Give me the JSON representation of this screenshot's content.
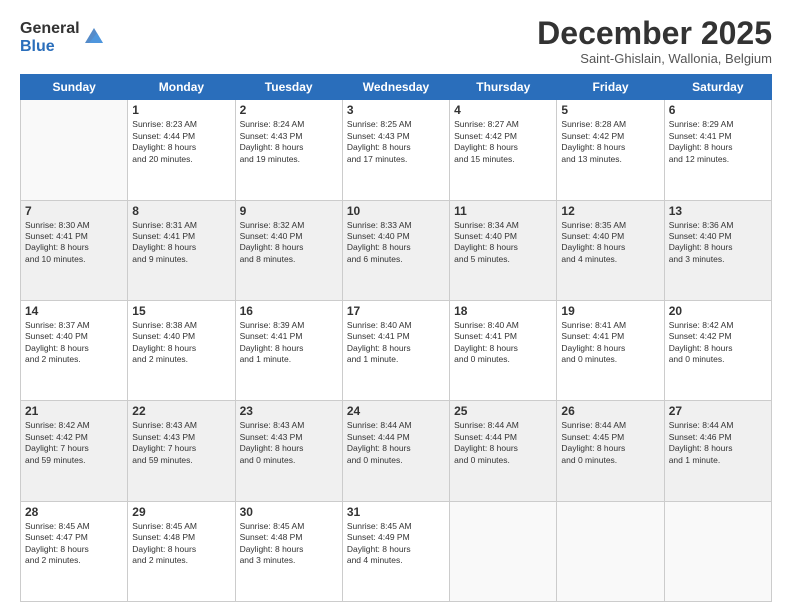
{
  "logo": {
    "general": "General",
    "blue": "Blue"
  },
  "header": {
    "month": "December 2025",
    "location": "Saint-Ghislain, Wallonia, Belgium"
  },
  "weekdays": [
    "Sunday",
    "Monday",
    "Tuesday",
    "Wednesday",
    "Thursday",
    "Friday",
    "Saturday"
  ],
  "weeks": [
    [
      {
        "day": "",
        "info": ""
      },
      {
        "day": "1",
        "info": "Sunrise: 8:23 AM\nSunset: 4:44 PM\nDaylight: 8 hours\nand 20 minutes."
      },
      {
        "day": "2",
        "info": "Sunrise: 8:24 AM\nSunset: 4:43 PM\nDaylight: 8 hours\nand 19 minutes."
      },
      {
        "day": "3",
        "info": "Sunrise: 8:25 AM\nSunset: 4:43 PM\nDaylight: 8 hours\nand 17 minutes."
      },
      {
        "day": "4",
        "info": "Sunrise: 8:27 AM\nSunset: 4:42 PM\nDaylight: 8 hours\nand 15 minutes."
      },
      {
        "day": "5",
        "info": "Sunrise: 8:28 AM\nSunset: 4:42 PM\nDaylight: 8 hours\nand 13 minutes."
      },
      {
        "day": "6",
        "info": "Sunrise: 8:29 AM\nSunset: 4:41 PM\nDaylight: 8 hours\nand 12 minutes."
      }
    ],
    [
      {
        "day": "7",
        "info": "Sunrise: 8:30 AM\nSunset: 4:41 PM\nDaylight: 8 hours\nand 10 minutes."
      },
      {
        "day": "8",
        "info": "Sunrise: 8:31 AM\nSunset: 4:41 PM\nDaylight: 8 hours\nand 9 minutes."
      },
      {
        "day": "9",
        "info": "Sunrise: 8:32 AM\nSunset: 4:40 PM\nDaylight: 8 hours\nand 8 minutes."
      },
      {
        "day": "10",
        "info": "Sunrise: 8:33 AM\nSunset: 4:40 PM\nDaylight: 8 hours\nand 6 minutes."
      },
      {
        "day": "11",
        "info": "Sunrise: 8:34 AM\nSunset: 4:40 PM\nDaylight: 8 hours\nand 5 minutes."
      },
      {
        "day": "12",
        "info": "Sunrise: 8:35 AM\nSunset: 4:40 PM\nDaylight: 8 hours\nand 4 minutes."
      },
      {
        "day": "13",
        "info": "Sunrise: 8:36 AM\nSunset: 4:40 PM\nDaylight: 8 hours\nand 3 minutes."
      }
    ],
    [
      {
        "day": "14",
        "info": "Sunrise: 8:37 AM\nSunset: 4:40 PM\nDaylight: 8 hours\nand 2 minutes."
      },
      {
        "day": "15",
        "info": "Sunrise: 8:38 AM\nSunset: 4:40 PM\nDaylight: 8 hours\nand 2 minutes."
      },
      {
        "day": "16",
        "info": "Sunrise: 8:39 AM\nSunset: 4:41 PM\nDaylight: 8 hours\nand 1 minute."
      },
      {
        "day": "17",
        "info": "Sunrise: 8:40 AM\nSunset: 4:41 PM\nDaylight: 8 hours\nand 1 minute."
      },
      {
        "day": "18",
        "info": "Sunrise: 8:40 AM\nSunset: 4:41 PM\nDaylight: 8 hours\nand 0 minutes."
      },
      {
        "day": "19",
        "info": "Sunrise: 8:41 AM\nSunset: 4:41 PM\nDaylight: 8 hours\nand 0 minutes."
      },
      {
        "day": "20",
        "info": "Sunrise: 8:42 AM\nSunset: 4:42 PM\nDaylight: 8 hours\nand 0 minutes."
      }
    ],
    [
      {
        "day": "21",
        "info": "Sunrise: 8:42 AM\nSunset: 4:42 PM\nDaylight: 7 hours\nand 59 minutes."
      },
      {
        "day": "22",
        "info": "Sunrise: 8:43 AM\nSunset: 4:43 PM\nDaylight: 7 hours\nand 59 minutes."
      },
      {
        "day": "23",
        "info": "Sunrise: 8:43 AM\nSunset: 4:43 PM\nDaylight: 8 hours\nand 0 minutes."
      },
      {
        "day": "24",
        "info": "Sunrise: 8:44 AM\nSunset: 4:44 PM\nDaylight: 8 hours\nand 0 minutes."
      },
      {
        "day": "25",
        "info": "Sunrise: 8:44 AM\nSunset: 4:44 PM\nDaylight: 8 hours\nand 0 minutes."
      },
      {
        "day": "26",
        "info": "Sunrise: 8:44 AM\nSunset: 4:45 PM\nDaylight: 8 hours\nand 0 minutes."
      },
      {
        "day": "27",
        "info": "Sunrise: 8:44 AM\nSunset: 4:46 PM\nDaylight: 8 hours\nand 1 minute."
      }
    ],
    [
      {
        "day": "28",
        "info": "Sunrise: 8:45 AM\nSunset: 4:47 PM\nDaylight: 8 hours\nand 2 minutes."
      },
      {
        "day": "29",
        "info": "Sunrise: 8:45 AM\nSunset: 4:48 PM\nDaylight: 8 hours\nand 2 minutes."
      },
      {
        "day": "30",
        "info": "Sunrise: 8:45 AM\nSunset: 4:48 PM\nDaylight: 8 hours\nand 3 minutes."
      },
      {
        "day": "31",
        "info": "Sunrise: 8:45 AM\nSunset: 4:49 PM\nDaylight: 8 hours\nand 4 minutes."
      },
      {
        "day": "",
        "info": ""
      },
      {
        "day": "",
        "info": ""
      },
      {
        "day": "",
        "info": ""
      }
    ]
  ]
}
